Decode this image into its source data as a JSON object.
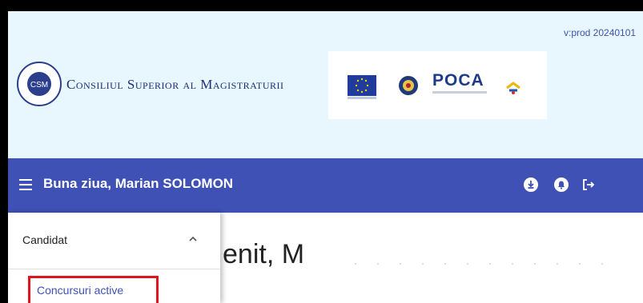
{
  "app": {
    "version": "v:prod 20240101",
    "brand_name": "Consiliul Superior al Magistraturii",
    "logo_text": "CSM",
    "partners": [
      "EU flag",
      "Romanian Government emblem",
      "POCA",
      "Program emblem"
    ],
    "poca_text": "POCA"
  },
  "toolbar": {
    "greeting": "Buna ziua, Marian SOLOMON",
    "icons": [
      "menu-icon",
      "download-icon",
      "notifications-icon",
      "logout-icon"
    ]
  },
  "sidenav": {
    "section_label": "Candidat",
    "section_expanded": true,
    "items": [
      {
        "label": "Concursuri active",
        "highlighted": true
      }
    ]
  },
  "main": {
    "welcome_text": "enit, M"
  },
  "colors": {
    "header_bg": "#e8f6fd",
    "toolbar_bg": "#3f51b5",
    "link": "#3f51b5",
    "highlight_border": "#e0141e"
  }
}
